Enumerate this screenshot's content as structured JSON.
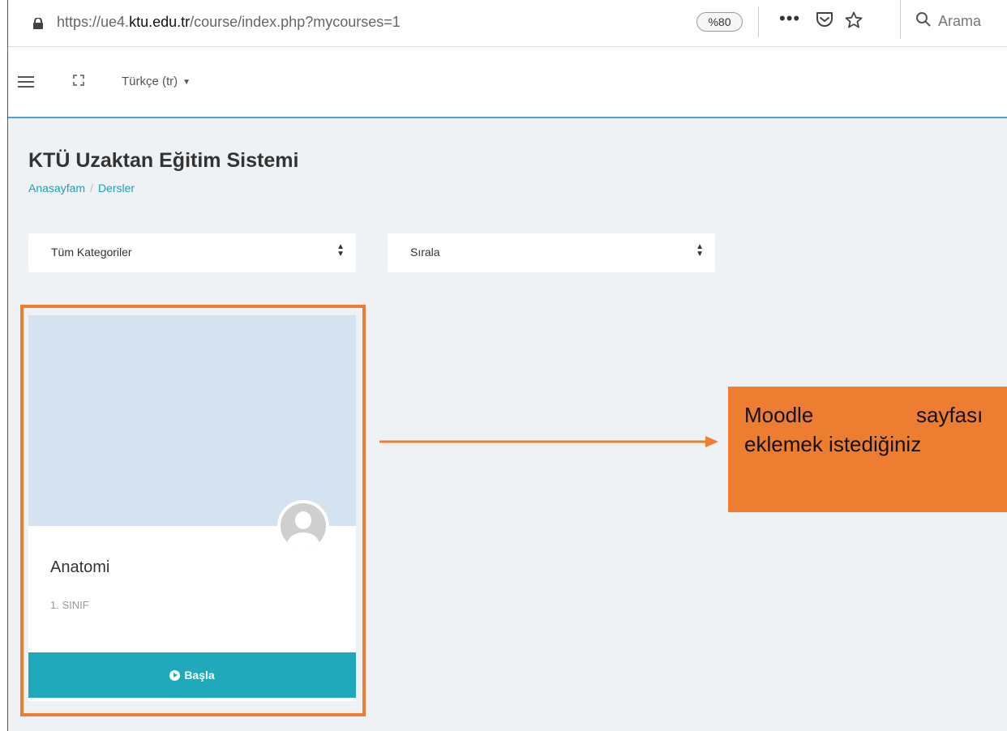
{
  "browser": {
    "url_prefix": "https://ue4.",
    "url_domain": "ktu.edu.tr",
    "url_path": "/course/index.php?mycourses=1",
    "zoom": "%80",
    "menu_dots": "•••",
    "search_placeholder": "Arama"
  },
  "nav": {
    "language": "Türkçe (tr)"
  },
  "page": {
    "site_title": "KTÜ Uzaktan Eğitim Sistemi",
    "breadcrumb": [
      "Anasayfam",
      "/",
      "Dersler"
    ]
  },
  "filters": {
    "category": "Tüm Kategoriler",
    "sort": "Sırala"
  },
  "course": {
    "name": "Anatomi",
    "category": "1. SINIF",
    "button": "Başla"
  },
  "annotation": {
    "line1_word1": "Moodle",
    "line1_word2": "sayfası",
    "line2": "eklemek istediğiniz",
    "accent_color": "#ed7d31"
  },
  "colors": {
    "teal": "#20a9ba",
    "link": "#1f9eb8",
    "card_image": "#d4e3ef"
  }
}
